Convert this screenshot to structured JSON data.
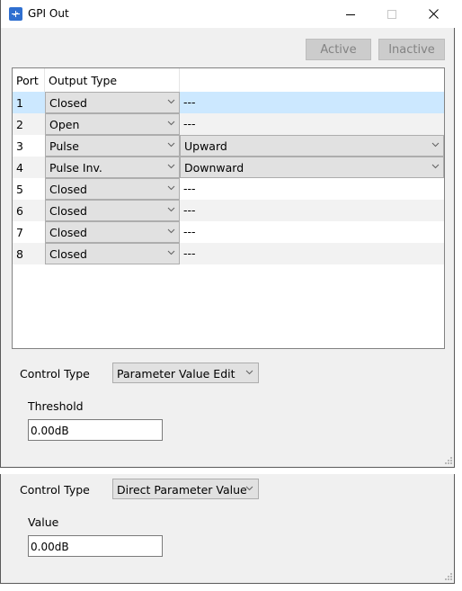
{
  "window": {
    "title": "GPI Out",
    "icon": "gpi-app-icon",
    "controls": {
      "minimize": "minimize-icon",
      "maximize": "maximize-icon",
      "close": "close-icon"
    }
  },
  "toolbar": {
    "active_label": "Active",
    "inactive_label": "Inactive"
  },
  "grid": {
    "columns": [
      "Port",
      "Output Type",
      ""
    ],
    "rows": [
      {
        "port": "1",
        "output_type": "Closed",
        "option": "---",
        "selected": true
      },
      {
        "port": "2",
        "output_type": "Open",
        "option": "---"
      },
      {
        "port": "3",
        "output_type": "Pulse",
        "option": "Upward"
      },
      {
        "port": "4",
        "output_type": "Pulse Inv.",
        "option": "Downward"
      },
      {
        "port": "5",
        "output_type": "Closed",
        "option": "---"
      },
      {
        "port": "6",
        "output_type": "Closed",
        "option": "---"
      },
      {
        "port": "7",
        "output_type": "Closed",
        "option": "---"
      },
      {
        "port": "8",
        "output_type": "Closed",
        "option": "---"
      }
    ]
  },
  "panel1": {
    "control_type_label": "Control Type",
    "control_type_value": "Parameter Value Edit",
    "field_label": "Threshold",
    "field_value": "0.00dB"
  },
  "panel2": {
    "control_type_label": "Control Type",
    "control_type_value": "Direct Parameter Value",
    "field_label": "Value",
    "field_value": "0.00dB"
  },
  "colors": {
    "selection": "#cce8ff",
    "disabled_button": "#cccccc",
    "app_icon": "#2f6fd0"
  }
}
